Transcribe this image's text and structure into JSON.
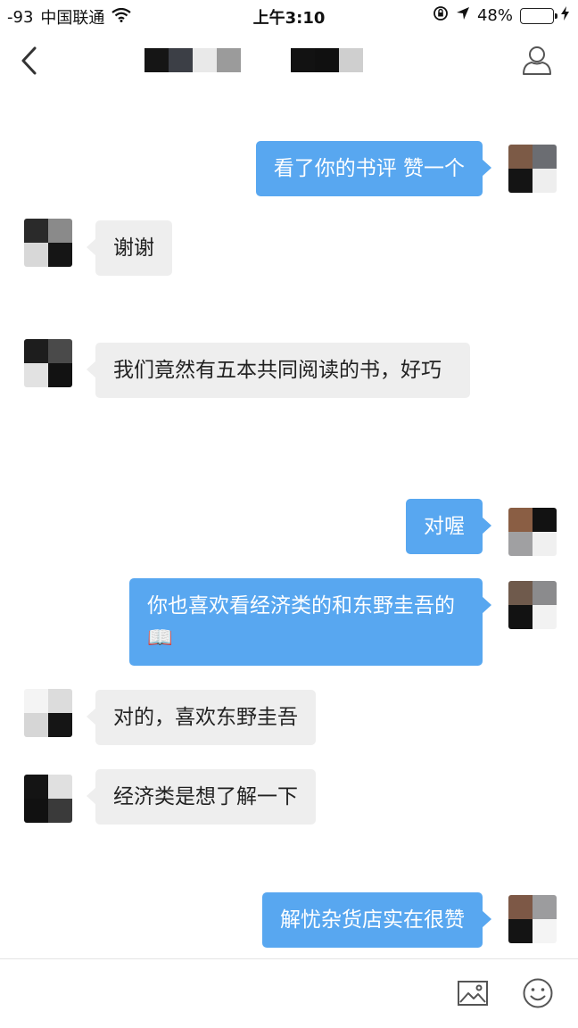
{
  "status_bar": {
    "signal": "-93",
    "carrier": "中国联通",
    "time": "上午3:10",
    "battery": "48%",
    "battery_level": 0.48
  },
  "nav": {
    "back_icon": "chevron-left-icon",
    "profile_icon": "person-icon"
  },
  "messages": [
    {
      "side": "me",
      "text": "看了你的书评 赞一个"
    },
    {
      "side": "them",
      "text": "谢谢"
    },
    {
      "side": "them",
      "text": "我们竟然有五本共同阅读的书，好巧"
    },
    {
      "side": "me",
      "text": "对喔"
    },
    {
      "side": "me",
      "text": "你也喜欢看经济类的和东野圭吾的📖"
    },
    {
      "side": "them",
      "text": "对的，喜欢东野圭吾"
    },
    {
      "side": "them",
      "text": "经济类是想了解一下"
    },
    {
      "side": "me",
      "text": "解忧杂货店实在很赞"
    }
  ],
  "input_bar": {
    "image_icon": "image-icon",
    "emoji_icon": "smiley-icon"
  },
  "colors": {
    "my_bubble": "#58a7f0",
    "their_bubble": "#eeeeee"
  }
}
